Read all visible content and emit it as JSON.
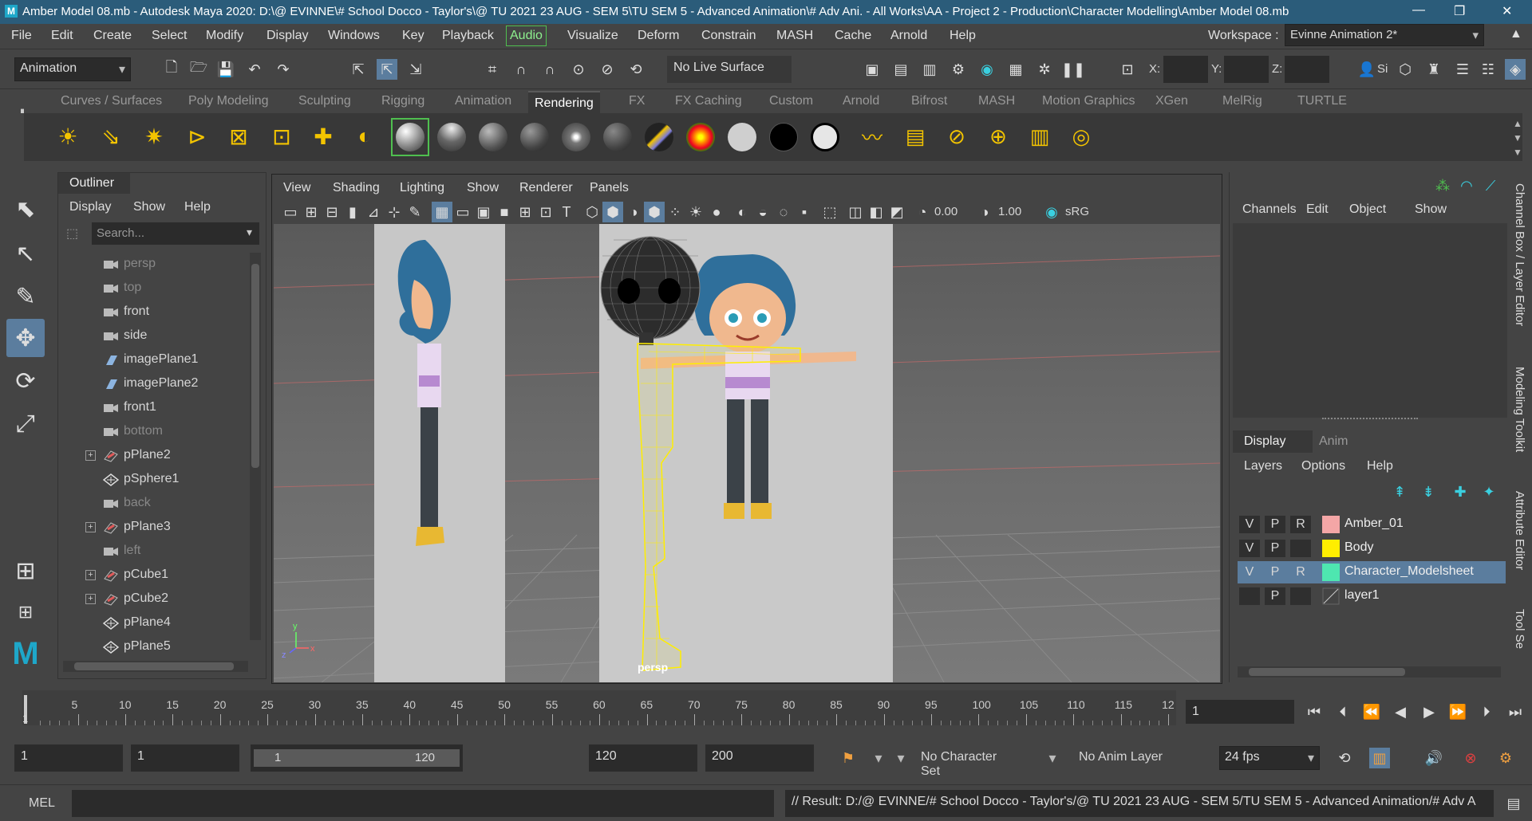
{
  "title": "Amber Model 08.mb - Autodesk Maya 2020: D:\\@ EVINNE\\# School Docco - Taylor's\\@ TU 2021 23 AUG - SEM 5\\TU SEM 5 - Advanced Animation\\# Adv Ani. - All Works\\AA - Project 2 - Production\\Character Modelling\\Amber Model 08.mb",
  "menus": [
    "File",
    "Edit",
    "Create",
    "Select",
    "Modify",
    "Display",
    "Windows",
    "Key",
    "Playback",
    "Audio",
    "Visualize",
    "Deform",
    "Constrain",
    "MASH",
    "Cache",
    "Arnold",
    "Help"
  ],
  "workspace": {
    "label": "Workspace :",
    "value": "Evinne Animation 2*"
  },
  "toolbar": {
    "mode": "Animation",
    "live_surface": "No Live Surface",
    "x": "X:",
    "y": "Y:",
    "z": "Z:",
    "sign_in": "Si"
  },
  "shelf_tabs": [
    "Curves / Surfaces",
    "Poly Modeling",
    "Sculpting",
    "Rigging",
    "Animation",
    "Rendering",
    "FX",
    "FX Caching",
    "Custom",
    "Arnold",
    "Bifrost",
    "MASH",
    "Motion Graphics",
    "XGen",
    "MelRig",
    "TURTLE"
  ],
  "shelf_active": "Rendering",
  "outliner": {
    "title": "Outliner",
    "menus": [
      "Display",
      "Show",
      "Help"
    ],
    "search_placeholder": "Search...",
    "items": [
      {
        "name": "persp",
        "dim": true,
        "type": "camera"
      },
      {
        "name": "top",
        "dim": true,
        "type": "camera"
      },
      {
        "name": "front",
        "dim": false,
        "type": "camera"
      },
      {
        "name": "side",
        "dim": false,
        "type": "camera"
      },
      {
        "name": "imagePlane1",
        "dim": false,
        "type": "image"
      },
      {
        "name": "imagePlane2",
        "dim": false,
        "type": "image"
      },
      {
        "name": "front1",
        "dim": false,
        "type": "camera"
      },
      {
        "name": "bottom",
        "dim": true,
        "type": "camera"
      },
      {
        "name": "pPlane2",
        "dim": false,
        "type": "mesh",
        "exp": true
      },
      {
        "name": "pSphere1",
        "dim": false,
        "type": "poly"
      },
      {
        "name": "back",
        "dim": true,
        "type": "camera"
      },
      {
        "name": "pPlane3",
        "dim": false,
        "type": "mesh",
        "exp": true
      },
      {
        "name": "left",
        "dim": true,
        "type": "camera"
      },
      {
        "name": "pCube1",
        "dim": false,
        "type": "mesh",
        "exp": true
      },
      {
        "name": "pCube2",
        "dim": false,
        "type": "mesh",
        "exp": true
      },
      {
        "name": "pPlane4",
        "dim": false,
        "type": "poly"
      },
      {
        "name": "pPlane5",
        "dim": false,
        "type": "poly"
      }
    ]
  },
  "viewport": {
    "menus": [
      "View",
      "Shading",
      "Lighting",
      "Show",
      "Renderer",
      "Panels"
    ],
    "val1": "0.00",
    "val2": "1.00",
    "color_space": "sRG",
    "camera_label": "persp"
  },
  "channels": {
    "menus": [
      "Channels",
      "Edit",
      "Object",
      "Show"
    ]
  },
  "layers": {
    "tabs": [
      "Display",
      "Anim"
    ],
    "menus": [
      "Layers",
      "Options",
      "Help"
    ],
    "rows": [
      {
        "v": "V",
        "p": "P",
        "r": "R",
        "color": "#f4a6a6",
        "name": "Amber_01",
        "selected": false
      },
      {
        "v": "V",
        "p": "P",
        "r": "",
        "color": "#ffee00",
        "name": "Body",
        "selected": false
      },
      {
        "v": "V",
        "p": "P",
        "r": "R",
        "color": "#4ee6b0",
        "name": "Character_Modelsheet",
        "selected": true
      },
      {
        "v": "",
        "p": "P",
        "r": "",
        "color": "",
        "name": "layer1",
        "selected": false
      }
    ]
  },
  "side_tabs": [
    "Channel Box / Layer Editor",
    "Modeling Toolkit",
    "Attribute Editor",
    "Tool Se"
  ],
  "timeline": {
    "ticks": [
      "5",
      "10",
      "15",
      "20",
      "25",
      "30",
      "35",
      "40",
      "45",
      "50",
      "55",
      "60",
      "65",
      "70",
      "75",
      "80",
      "85",
      "90",
      "95",
      "100",
      "105",
      "110",
      "115",
      "12"
    ],
    "start_marker": "1",
    "current": "1"
  },
  "range": {
    "start": "1",
    "start2": "1",
    "slider_start": "1",
    "slider_end": "120",
    "end": "120",
    "end2": "200",
    "char_set": "No Character Set",
    "anim_layer": "No Anim Layer",
    "fps": "24 fps"
  },
  "cmd": {
    "lang": "MEL",
    "result": "// Result: D:/@ EVINNE/# School Docco - Taylor's/@ TU 2021 23 AUG - SEM 5/TU SEM 5 - Advanced Animation/# Adv A"
  }
}
